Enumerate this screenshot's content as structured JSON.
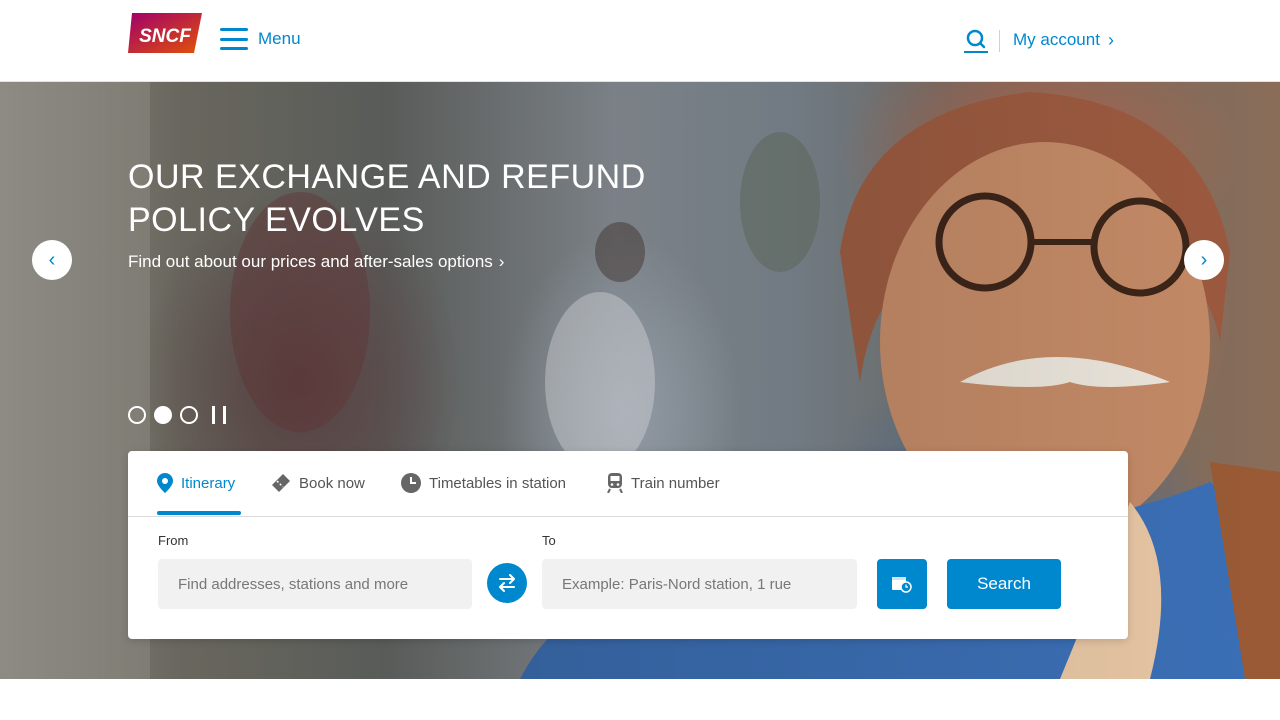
{
  "header": {
    "logo_text": "SNCF",
    "menu_label": "Menu",
    "account_label": "My account",
    "account_chevron": "›",
    "icons": {
      "logo": "sncf-logo",
      "menu": "hamburger-icon",
      "search": "search-icon"
    }
  },
  "hero": {
    "title": "OUR EXCHANGE AND REFUND POLICY EVOLVES",
    "subtitle": "Find out about our prices and after-sales options",
    "subtitle_chevron": "›",
    "prev_icon": "‹",
    "next_icon": "›",
    "slides_total": 3,
    "slide_active": 2
  },
  "search": {
    "tabs": [
      {
        "label": "Itinerary",
        "icon": "location-pin-icon"
      },
      {
        "label": "Book now",
        "icon": "ticket-icon"
      },
      {
        "label": "Timetables in station",
        "icon": "clock-icon"
      },
      {
        "label": "Train number",
        "icon": "train-icon"
      }
    ],
    "active_tab": 0,
    "from_label": "From",
    "from_placeholder": "Find addresses, stations and more",
    "to_label": "To",
    "to_placeholder": "Example: Paris-Nord station, 1 rue",
    "search_button": "Search"
  },
  "colors": {
    "accent": "#0088ce",
    "logo_gradient_start": "#a1006b",
    "logo_gradient_end": "#e05206"
  }
}
